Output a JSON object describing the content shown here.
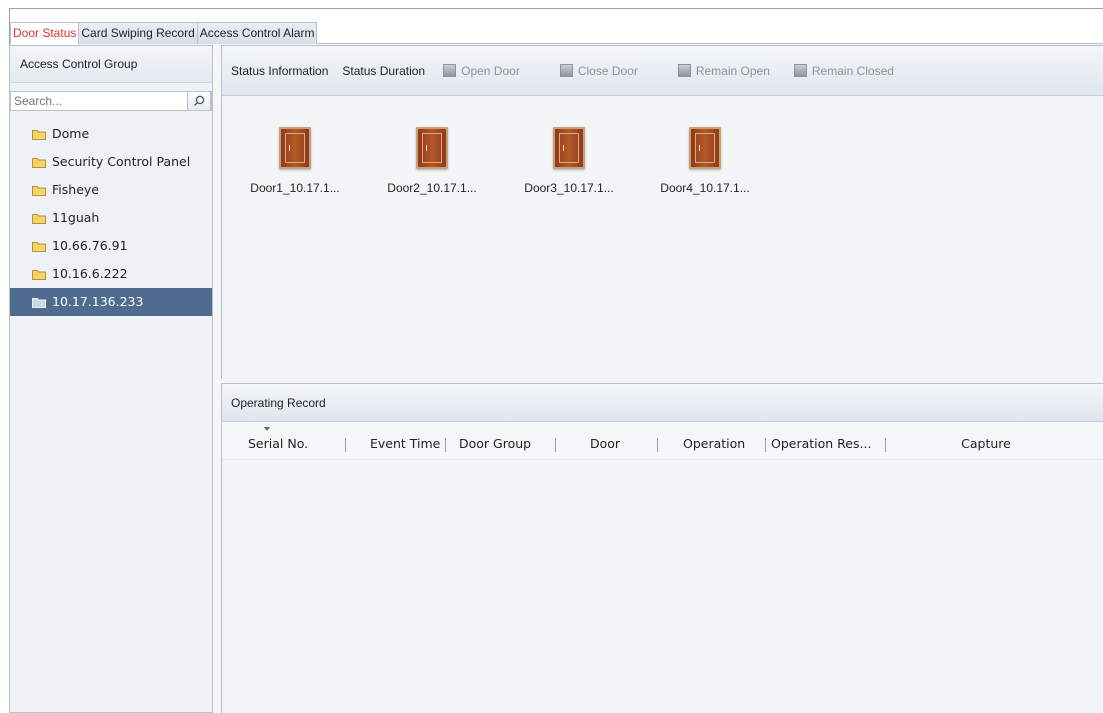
{
  "tabs": [
    {
      "label": "Door Status",
      "active": true
    },
    {
      "label": "Card Swiping Record",
      "active": false
    },
    {
      "label": "Access Control Alarm",
      "active": false
    }
  ],
  "sidebar": {
    "header": "Access Control Group",
    "search_placeholder": "Search...",
    "items": [
      {
        "label": "Dome",
        "selected": false
      },
      {
        "label": "Security Control Panel",
        "selected": false
      },
      {
        "label": "Fisheye",
        "selected": false
      },
      {
        "label": "11guah",
        "selected": false
      },
      {
        "label": "10.66.76.91",
        "selected": false
      },
      {
        "label": "10.16.6.222",
        "selected": false
      },
      {
        "label": "10.17.136.233",
        "selected": true
      }
    ]
  },
  "toolbar": {
    "status_information": "Status Information",
    "status_duration": "Status Duration",
    "open_door": "Open Door",
    "close_door": "Close Door",
    "remain_open": "Remain Open",
    "remain_closed": "Remain Closed"
  },
  "doors": [
    {
      "label": "Door1_10.17.1..."
    },
    {
      "label": "Door2_10.17.1..."
    },
    {
      "label": "Door3_10.17.1..."
    },
    {
      "label": "Door4_10.17.1..."
    }
  ],
  "record": {
    "title": "Operating Record",
    "columns": [
      "Serial No.",
      "Event Time",
      "Door Group",
      "Door",
      "Operation",
      "Operation Res...",
      "Capture"
    ]
  },
  "colors": {
    "active_tab_text": "#d9342b",
    "selected_item_bg": "#4f6c8f",
    "door_brown": "#b45a2a"
  }
}
